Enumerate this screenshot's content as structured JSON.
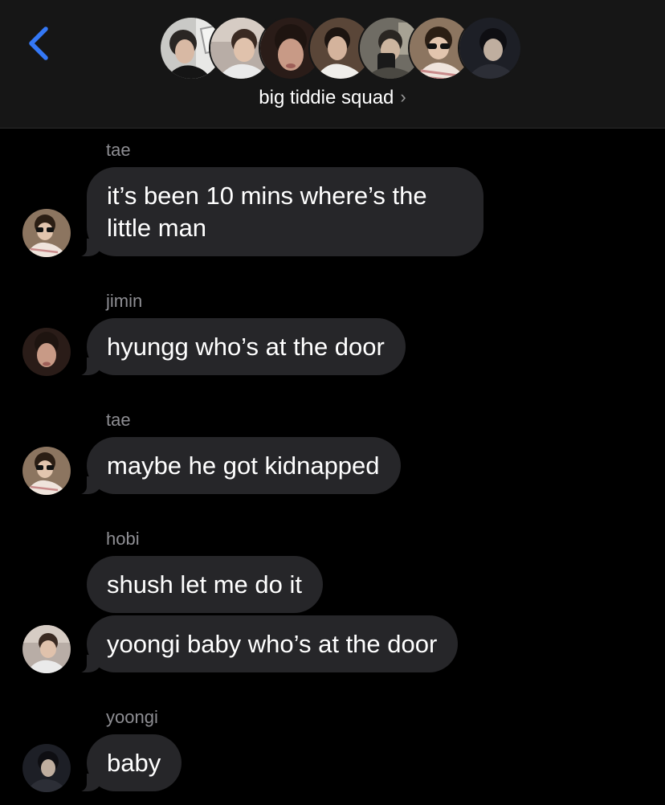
{
  "header": {
    "group_name": "big tiddie squad",
    "chevron": "›",
    "back_icon": "chevron-left-icon",
    "accent_color": "#3478F6",
    "members": [
      "jungkook-avatar",
      "hobi-avatar",
      "jimin-avatar",
      "jin-avatar",
      "namjoon-avatar",
      "tae-avatar",
      "yoongi-avatar"
    ]
  },
  "messages": [
    {
      "sender": "tae",
      "text_line1": "it’s been 10 mins where’s the",
      "text_line2": "little man"
    },
    {
      "sender": "jimin",
      "text": "hyungg who’s at the door"
    },
    {
      "sender": "tae",
      "text": "maybe he got kidnapped"
    },
    {
      "sender": "hobi",
      "text1": "shush let me do it",
      "text2": "yoongi baby who’s at the door"
    },
    {
      "sender": "yoongi",
      "text": "baby"
    }
  ],
  "colors": {
    "background": "#000000",
    "header_bg": "#161616",
    "bubble": "#262629",
    "sender_label": "#8E8E93"
  }
}
